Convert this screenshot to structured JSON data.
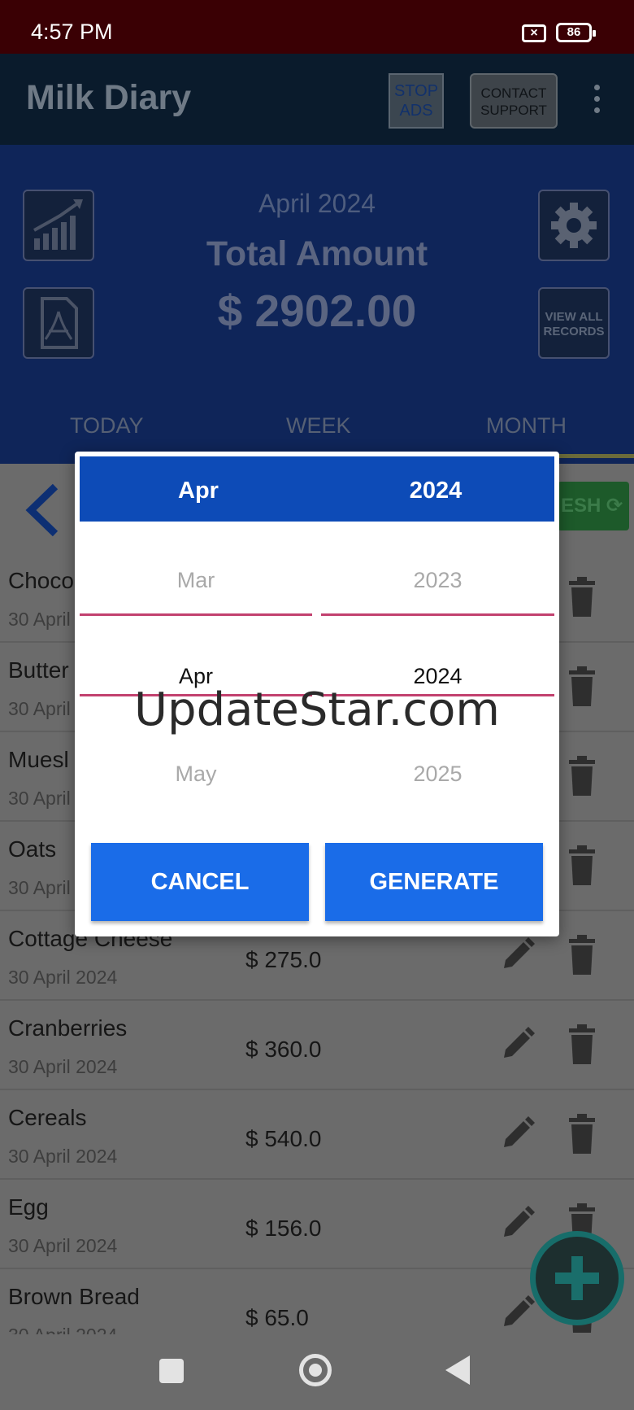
{
  "status_bar": {
    "time": "4:57 PM",
    "battery": "86"
  },
  "app_bar": {
    "title": "Milk Diary",
    "stop_ads": "STOP ADS",
    "contact_support": "CONTACT SUPPORT"
  },
  "summary": {
    "month": "April 2024",
    "total_label": "Total Amount",
    "total_value": "$ 2902.00",
    "view_all": "VIEW ALL RECORDS"
  },
  "tabs": [
    "TODAY",
    "WEEK",
    "MONTH"
  ],
  "refresh_label": "ESH",
  "records": [
    {
      "name": "Choco",
      "date": "30 April",
      "amount": ""
    },
    {
      "name": "Butter",
      "date": "30 April",
      "amount": ""
    },
    {
      "name": "Muesl",
      "date": "30 April",
      "amount": ""
    },
    {
      "name": "Oats",
      "date": "30 April",
      "amount": ""
    },
    {
      "name": "Cottage Cheese",
      "date": "30 April 2024",
      "amount": "$ 275.0"
    },
    {
      "name": "Cranberries",
      "date": "30 April 2024",
      "amount": "$ 360.0"
    },
    {
      "name": "Cereals",
      "date": "30 April 2024",
      "amount": "$ 540.0"
    },
    {
      "name": "Egg",
      "date": "30 April 2024",
      "amount": "$ 156.0"
    },
    {
      "name": "Brown Bread",
      "date": "30 April 2024",
      "amount": "$ 65.0"
    }
  ],
  "dialog": {
    "selected_month": "Apr",
    "selected_year": "2024",
    "months": {
      "prev": "Mar",
      "current": "Apr",
      "next": "May"
    },
    "years": {
      "prev": "2023",
      "current": "2024",
      "next": "2025"
    },
    "cancel": "CANCEL",
    "generate": "GENERATE"
  },
  "watermark": "UpdateStar.com",
  "colors": {
    "header_blue": "#0d4bb7",
    "button_blue": "#1a6ce8",
    "divider_pink": "#c2416f"
  }
}
